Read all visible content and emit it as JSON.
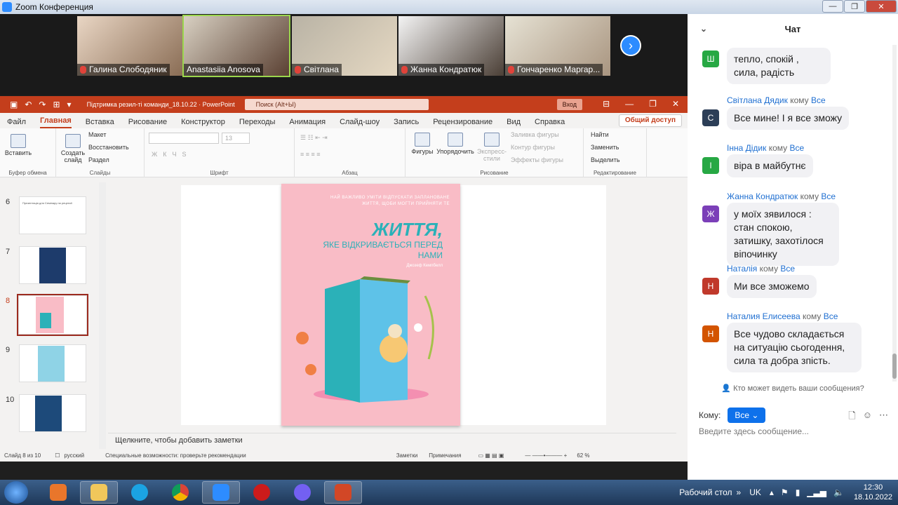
{
  "zoom": {
    "title": "Zoom Конференция",
    "participants": [
      {
        "name": "Галина Слободяник",
        "muted": true
      },
      {
        "name": "Anastasiia Anosova",
        "muted": false
      },
      {
        "name": "Світлана",
        "muted": true
      },
      {
        "name": "Жанна Кондратюк",
        "muted": true
      },
      {
        "name": "Гончаренко Маргар...",
        "muted": true
      }
    ]
  },
  "ppt": {
    "doc_title": "Підтримка резил-ті команди_18.10.22 · PowerPoint",
    "search_placeholder": "Поиск (Alt+Ы)",
    "login": "Вход",
    "tabs": [
      "Файл",
      "Главная",
      "Вставка",
      "Рисование",
      "Конструктор",
      "Переходы",
      "Анимация",
      "Слайд-шоу",
      "Запись",
      "Рецензирование",
      "Вид",
      "Справка"
    ],
    "active_tab": "Главная",
    "share": "Общий доступ",
    "ribbon": {
      "paste": "Вставить",
      "clipboard_group": "Буфер обмена",
      "create_slide": "Создать слайд",
      "layout": "Макет",
      "reset": "Восстановить",
      "section": "Раздел",
      "slides_group": "Слайды",
      "font_size": "13",
      "font_group": "Шрифт",
      "paragraph_group": "Абзац",
      "shapes": "Фигуры",
      "arrange": "Упорядочить",
      "express_styles": "Экспресс-стили",
      "fill": "Заливка фигуры",
      "outline": "Контур фигуры",
      "effects": "Эффекты фигуры",
      "drawing_group": "Рисование",
      "find": "Найти",
      "replace": "Заменить",
      "select": "Выделить",
      "editing_group": "Редактирование"
    },
    "thumbnails": [
      {
        "num": "6",
        "text": "Презентація для Семінару на рецензії"
      },
      {
        "num": "7",
        "text": ""
      },
      {
        "num": "8",
        "text": ""
      },
      {
        "num": "9",
        "text": ""
      },
      {
        "num": "10",
        "text": ""
      }
    ],
    "selected_slide": "8",
    "slide": {
      "subtitle": "НАЙ ВАЖЛИВО УМІТИ ВІДПУСКАТИ ЗАПЛАНОВАНЕ ЖИТТЯ, ЩОБИ МОГТИ ПРИЙНЯТИ ТЕ",
      "title_big": "ЖИТТЯ,",
      "title_rest": "ЯКЕ ВІДКРИВАЄТЬСЯ ПЕРЕД НАМИ",
      "author": "Джозеф Кемпбелл"
    },
    "notes_placeholder": "Щелкните, чтобы добавить заметки",
    "status": {
      "slide_count": "Слайд 8 из 10",
      "language": "русский",
      "accessibility": "Специальные возможности: проверьте рекомендации",
      "notes": "Заметки",
      "comments": "Примечания",
      "zoom": "62 %"
    }
  },
  "chat": {
    "title": "Чат",
    "messages": [
      {
        "initial": "Ш",
        "color": "#27a844",
        "sender": "",
        "to": "",
        "to_target": "",
        "text": "тепло, спокій , сила, радість"
      },
      {
        "initial": "С",
        "color": "#2c3e57",
        "sender": "Світлана Дядик",
        "to": "кому",
        "to_target": "Все",
        "text": "Все мине! І я все зможу"
      },
      {
        "initial": "І",
        "color": "#27a844",
        "sender": "Інна Дідик",
        "to": "кому",
        "to_target": "Все",
        "text": "віра в майбутнє"
      },
      {
        "initial": "Ж",
        "color": "#7b3fb8",
        "sender": "Жанна Кондратюк",
        "to": "кому",
        "to_target": "Все",
        "text": "у моїх зявилося : стан спокою, затишку, захотілося віпочинку"
      },
      {
        "initial": "Н",
        "color": "#c0392b",
        "sender": "Наталія",
        "to": "кому",
        "to_target": "Все",
        "text": "Ми все зможемо"
      },
      {
        "initial": "Н",
        "color": "#d35400",
        "sender": "Наталия Елисеева",
        "to": "кому",
        "to_target": "Все",
        "text": "Все чудово складається на ситуацію сьогодення, сила та добра зпість."
      }
    ],
    "privacy": "Кто может видеть ваши сообщения?",
    "to_label": "Кому:",
    "to_value": "Все",
    "input_placeholder": "Введите здесь сообщение..."
  },
  "taskbar": {
    "desktop": "Рабочий стол",
    "lang": "UK",
    "time": "12:30",
    "date": "18.10.2022"
  }
}
